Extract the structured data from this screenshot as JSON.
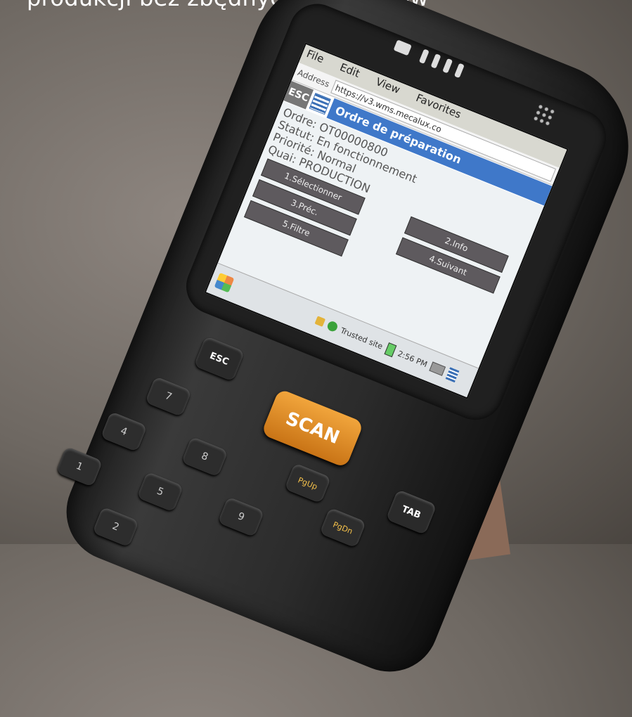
{
  "headline": "produkcji bez zbędnych przestojów",
  "device": {
    "menu": [
      "File",
      "Edit",
      "View",
      "Favorites"
    ],
    "address_label": "Address",
    "address": "https://v3.wms.mecalux.co",
    "esc_label": "ESC",
    "page_title": "Ordre de préparation",
    "details": [
      "Ordre: OT00000800",
      "Statut: En fonctionnement",
      "Priorité: Normal",
      "Quai: PRODUCTION"
    ],
    "buttons": [
      "1.Sélectionner",
      "2.Info",
      "3.Préc.",
      "4.Suivant",
      "5.Filtre"
    ],
    "status_text": "Trusted site",
    "time": "2:56 PM"
  },
  "keypad": {
    "esc": "ESC",
    "scan": "SCAN",
    "tab": "TAB",
    "pgup": "PgUp",
    "pgdn": "PgDn",
    "numbers": [
      "7",
      "8",
      "9",
      "4",
      "5",
      "1",
      "2"
    ]
  }
}
